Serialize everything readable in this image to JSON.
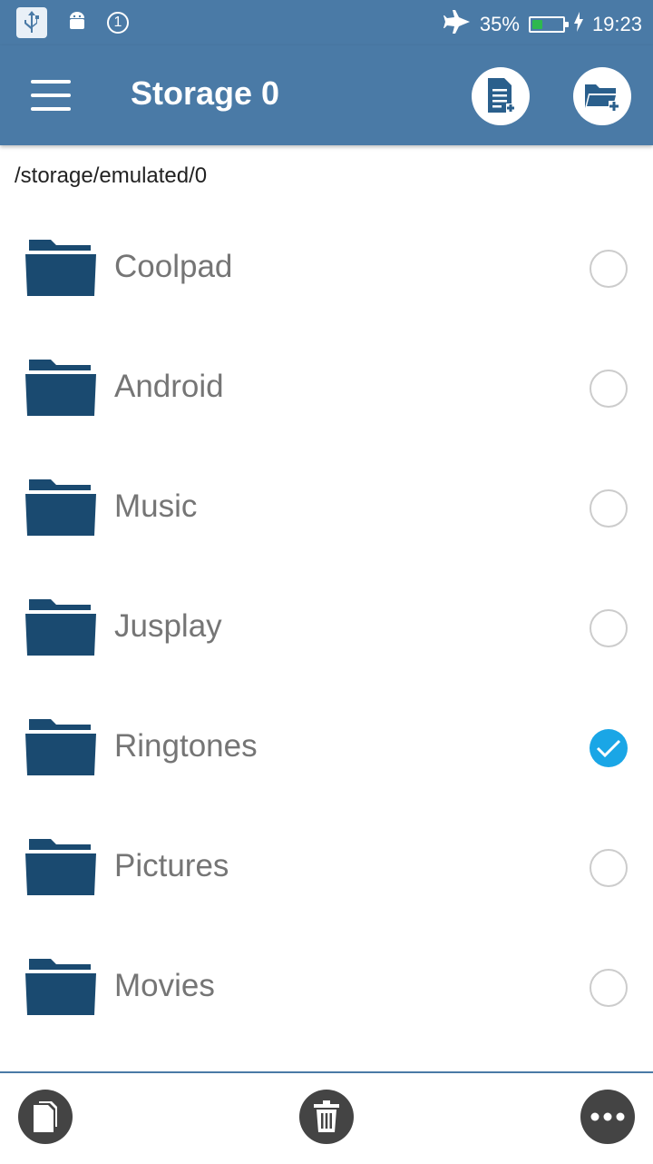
{
  "status_bar": {
    "notification_count": "1",
    "battery_percent": "35%",
    "battery_level": 0.35,
    "time": "19:23",
    "icons": [
      "usb-icon",
      "android-icon",
      "notification-count-icon",
      "airplane-mode-icon",
      "battery-icon",
      "charging-icon"
    ]
  },
  "app_bar": {
    "title": "Storage 0",
    "actions": [
      "new-file-icon",
      "new-folder-icon"
    ]
  },
  "path": "/storage/emulated/0",
  "folders": [
    {
      "name": "Coolpad",
      "checked": false
    },
    {
      "name": "Android",
      "checked": false
    },
    {
      "name": "Music",
      "checked": false
    },
    {
      "name": "Jusplay",
      "checked": false
    },
    {
      "name": "Ringtones",
      "checked": true
    },
    {
      "name": "Pictures",
      "checked": false
    },
    {
      "name": "Movies",
      "checked": false
    }
  ],
  "bottom_bar": {
    "actions": [
      "copy-icon",
      "delete-icon",
      "more-icon"
    ]
  },
  "colors": {
    "app_bar": "#4a7aa6",
    "folder": "#1a4a70",
    "checked": "#1aa6e6",
    "battery_fill": "#2eb84f",
    "bottom_button": "#444444"
  }
}
